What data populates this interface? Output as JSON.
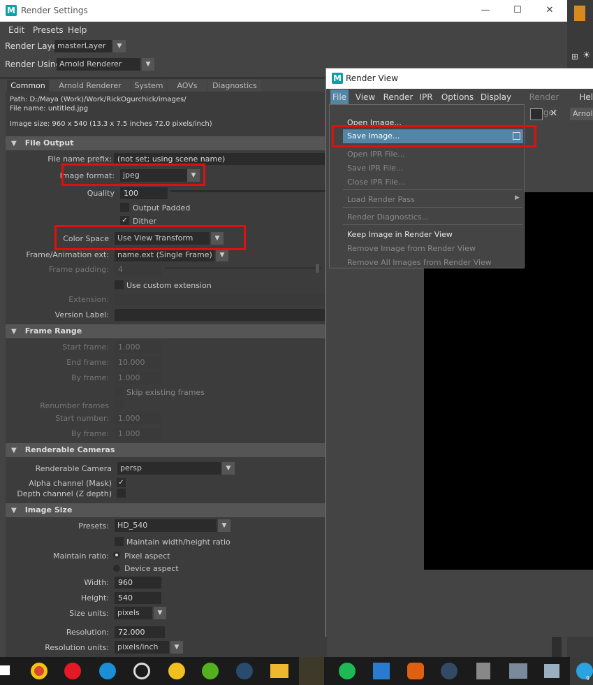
{
  "render_settings": {
    "title": "Render Settings",
    "menu": [
      "Edit",
      "Presets",
      "Help"
    ],
    "render_layer_label": "Render Layer",
    "render_layer_value": "masterLayer",
    "render_using_label": "Render Using",
    "render_using_value": "Arnold Renderer",
    "tabs": [
      "Common",
      "Arnold Renderer",
      "System",
      "AOVs",
      "Diagnostics"
    ],
    "path": "Path: D:/Maya (Work)/Work/RickOgurchick/images/",
    "file_name": "File name:  untitled.jpg",
    "image_size": "Image size: 960 x 540 (13.3 x 7.5 inches 72.0 pixels/inch)",
    "file_output": {
      "header": "File Output",
      "prefix_label": "File name prefix:",
      "prefix_value": "(not set; using scene name)",
      "format_label": "Image format:",
      "format_value": "jpeg",
      "quality_label": "Quality",
      "quality_value": "100",
      "output_padded": "Output Padded",
      "dither": "Dither",
      "color_space_label": "Color Space",
      "color_space_value": "Use View Transform",
      "frame_ext_label": "Frame/Animation ext:",
      "frame_ext_value": "name.ext (Single Frame)",
      "frame_padding_label": "Frame padding:",
      "frame_padding_value": "4",
      "custom_ext": "Use custom extension",
      "extension_label": "Extension:",
      "version_label": "Version Label:"
    },
    "frame_range": {
      "header": "Frame Range",
      "start_label": "Start frame:",
      "start_value": "1.000",
      "end_label": "End frame:",
      "end_value": "10.000",
      "by_label": "By frame:",
      "by_value": "1.000",
      "skip": "Skip existing frames",
      "renumber_label": "Renumber frames",
      "start_number_label": "Start number:",
      "start_number_value": "1.000",
      "by2_label": "By frame:",
      "by2_value": "1.000"
    },
    "cameras": {
      "header": "Renderable Cameras",
      "camera_label": "Renderable Camera",
      "camera_value": "persp",
      "alpha_label": "Alpha channel (Mask)",
      "depth_label": "Depth channel (Z depth)"
    },
    "image_size_section": {
      "header": "Image Size",
      "presets_label": "Presets:",
      "presets_value": "HD_540",
      "maintain_wh": "Maintain width/height ratio",
      "maintain_ratio_label": "Maintain ratio:",
      "pixel_aspect": "Pixel aspect",
      "device_aspect": "Device aspect",
      "width_label": "Width:",
      "width_value": "960",
      "height_label": "Height:",
      "height_value": "540",
      "size_units_label": "Size units:",
      "size_units_value": "pixels",
      "resolution_label": "Resolution:",
      "resolution_value": "72.000",
      "res_units_label": "Resolution units:",
      "res_units_value": "pixels/inch"
    }
  },
  "render_view": {
    "title": "Render View",
    "menu": [
      "File",
      "View",
      "Render",
      "IPR",
      "Options",
      "Display",
      "Render Target",
      "Help"
    ],
    "toolbar_dropdown": "Arnold",
    "file_menu": [
      "Open Image...",
      "Save Image...",
      "Open IPR File...",
      "Save IPR File...",
      "Close IPR File...",
      "Load Render Pass",
      "Render Diagnostics...",
      "Keep Image in Render View",
      "Remove Image from Render View",
      "Remove All Images from Render View"
    ]
  },
  "taskbar": {
    "badge": "9"
  },
  "colors": {
    "highlight": "#e01010",
    "menu_selected": "#5285a6",
    "brand": "#0aa0a8"
  }
}
